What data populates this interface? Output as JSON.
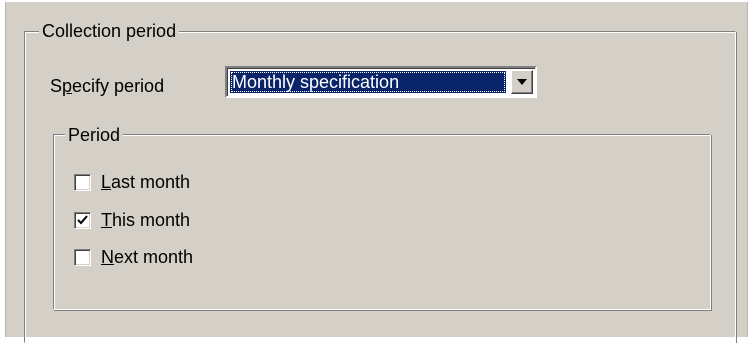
{
  "collection_group": {
    "title": "Collection period"
  },
  "specify_period": {
    "label_prefix": "S",
    "label_accel": "p",
    "label_rest": "ecify period",
    "selected_value": "Monthly specification"
  },
  "period_group": {
    "title": "Period",
    "options": [
      {
        "accel": "L",
        "rest": "ast month",
        "checked": false
      },
      {
        "accel": "T",
        "rest": "his month",
        "checked": true
      },
      {
        "accel": "N",
        "rest": "ext month",
        "checked": false
      }
    ]
  },
  "icons": {
    "dropdown": "chevron-down-icon",
    "check": "checkmark-icon"
  },
  "colors": {
    "face": "#d4d0c8",
    "selection": "#0a246a"
  }
}
